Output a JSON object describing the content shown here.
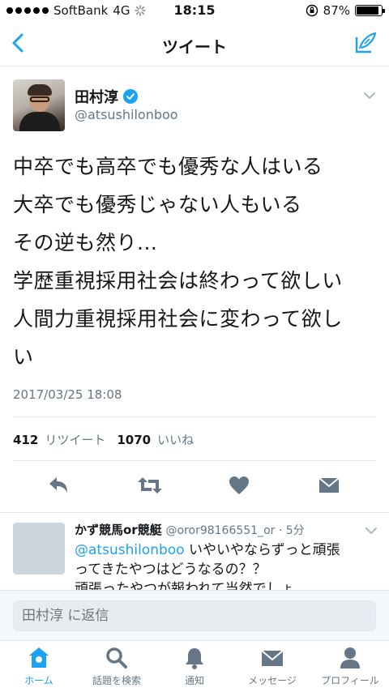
{
  "status_bar": {
    "carrier": "SoftBank",
    "network": "4G",
    "time": "18:15",
    "battery": "87%"
  },
  "nav": {
    "title": "ツイート",
    "back_icon": "chevron-left-icon",
    "compose_icon": "compose-icon"
  },
  "tweet": {
    "display_name": "田村淳",
    "handle": "@atsushilonboo",
    "verified": true,
    "lines": [
      "中卒でも高卒でも優秀な人はいる",
      "大卒でも優秀じゃない人もいる",
      "その逆も然り...",
      "学歴重視採用社会は終わって欲しい",
      "人間力重視採用社会に変わって欲し",
      "い"
    ],
    "timestamp": "2017/03/25 18:08",
    "retweet_count": "412",
    "retweet_label": "リツイート",
    "like_count": "1070",
    "like_label": "いいね"
  },
  "reply": {
    "name": "かず競馬or競艇",
    "handle_time": "@oror98166551_or · 5分",
    "mention": "@atsushilonboo",
    "text_1": " いやいやならずっと頑張",
    "text_2": "ってきたやつはどうなるの？？",
    "text_3": "頑張ったやつが報われて当然でしょ"
  },
  "composer": {
    "placeholder": "田村淳 に返信"
  },
  "tabs": [
    {
      "label": "ホーム",
      "icon": "home-icon"
    },
    {
      "label": "話題を検索",
      "icon": "search-icon"
    },
    {
      "label": "通知",
      "icon": "bell-icon"
    },
    {
      "label": "メッセージ",
      "icon": "envelope-icon"
    },
    {
      "label": "プロフィール",
      "icon": "person-icon"
    }
  ],
  "colors": {
    "accent": "#1da1f2",
    "action_icon": "#657786",
    "divider": "#e1e8ed"
  }
}
